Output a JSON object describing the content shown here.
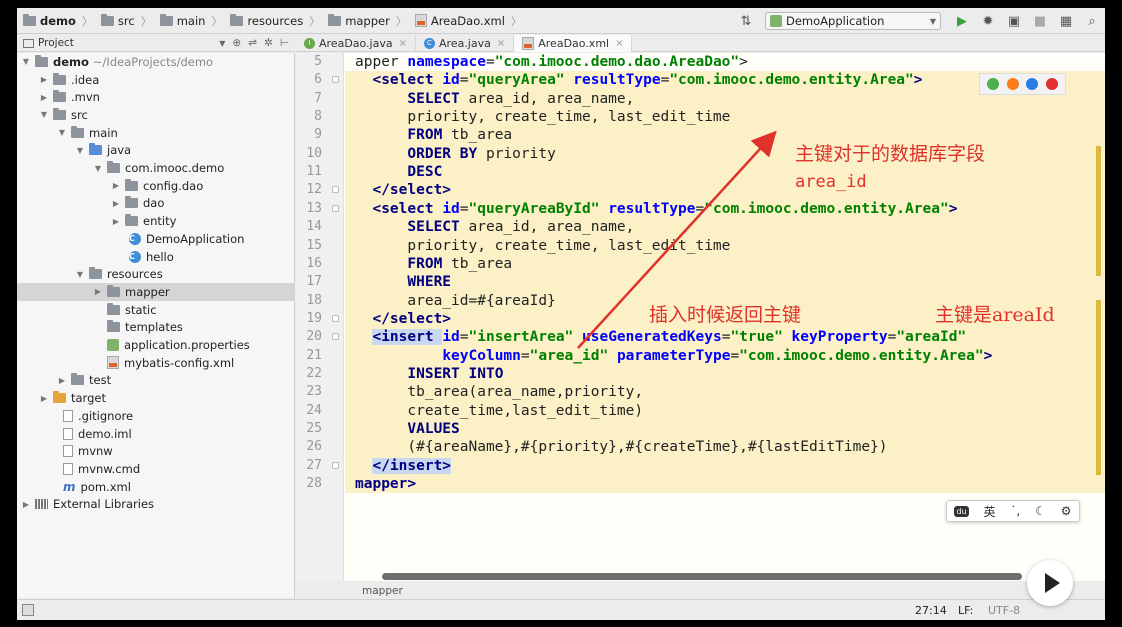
{
  "navbar": {
    "crumbs": [
      "demo",
      "src",
      "main",
      "resources",
      "mapper",
      "AreaDao.xml"
    ],
    "run_config": "DemoApplication"
  },
  "project_panel": {
    "title": "Project",
    "items": [
      {
        "label": "demo",
        "hint": "~/IdeaProjects/demo"
      },
      {
        "label": ".idea"
      },
      {
        "label": ".mvn"
      },
      {
        "label": "src"
      },
      {
        "label": "main"
      },
      {
        "label": "java"
      },
      {
        "label": "com.imooc.demo"
      },
      {
        "label": "config.dao"
      },
      {
        "label": "dao"
      },
      {
        "label": "entity"
      },
      {
        "label": "DemoApplication"
      },
      {
        "label": "hello"
      },
      {
        "label": "resources"
      },
      {
        "label": "mapper"
      },
      {
        "label": "static"
      },
      {
        "label": "templates"
      },
      {
        "label": "application.properties"
      },
      {
        "label": "mybatis-config.xml"
      },
      {
        "label": "test"
      },
      {
        "label": "target"
      },
      {
        "label": ".gitignore"
      },
      {
        "label": "demo.iml"
      },
      {
        "label": "mvnw"
      },
      {
        "label": "mvnw.cmd"
      },
      {
        "label": "pom.xml"
      },
      {
        "label": "External Libraries"
      }
    ]
  },
  "tabs": [
    {
      "label": "AreaDao.java"
    },
    {
      "label": "Area.java"
    },
    {
      "label": "AreaDao.xml"
    }
  ],
  "editor": {
    "line_numbers": [
      "5",
      "6",
      "7",
      "8",
      "9",
      "10",
      "11",
      "12",
      "13",
      "14",
      "15",
      "16",
      "17",
      "18",
      "19",
      "20",
      "21",
      "22",
      "23",
      "24",
      "25",
      "26",
      "27",
      "28"
    ],
    "lines": [
      [
        [
          "t",
          "apper "
        ],
        [
          "at",
          "namespace"
        ],
        [
          "t",
          "="
        ],
        [
          "sv",
          "\"com.imooc.demo.dao.AreaDao\""
        ],
        [
          "t",
          ">"
        ]
      ],
      [
        [
          "t",
          "  "
        ],
        [
          "tg",
          "<select "
        ],
        [
          "at",
          "id"
        ],
        [
          "t",
          "="
        ],
        [
          "sv",
          "\"queryArea\" "
        ],
        [
          "at",
          "resultType"
        ],
        [
          "t",
          "="
        ],
        [
          "sv",
          "\"com.imooc.demo.entity.Area\""
        ],
        [
          "tg",
          ">"
        ]
      ],
      [
        [
          "t",
          "      "
        ],
        [
          "kw",
          "SELECT "
        ],
        [
          "t",
          "area_id, area_name,"
        ]
      ],
      [
        [
          "t",
          "      priority, create_time, last_edit_time"
        ]
      ],
      [
        [
          "t",
          "      "
        ],
        [
          "kw",
          "FROM "
        ],
        [
          "t",
          "tb_area"
        ]
      ],
      [
        [
          "t",
          "      "
        ],
        [
          "kw",
          "ORDER BY "
        ],
        [
          "t",
          "priority"
        ]
      ],
      [
        [
          "t",
          "      "
        ],
        [
          "kw",
          "DESC"
        ]
      ],
      [
        [
          "t",
          "  "
        ],
        [
          "tg",
          "</select>"
        ]
      ],
      [
        [
          "t",
          "  "
        ],
        [
          "tg",
          "<select "
        ],
        [
          "at",
          "id"
        ],
        [
          "t",
          "="
        ],
        [
          "sv",
          "\"queryAreaById\" "
        ],
        [
          "at",
          "resultType"
        ],
        [
          "t",
          "="
        ],
        [
          "sv",
          "\"com.imooc.demo.entity.Area\""
        ],
        [
          "tg",
          ">"
        ]
      ],
      [
        [
          "t",
          "      "
        ],
        [
          "kw",
          "SELECT "
        ],
        [
          "t",
          "area_id, area_name,"
        ]
      ],
      [
        [
          "t",
          "      priority, create_time, last_edit_time"
        ]
      ],
      [
        [
          "t",
          "      "
        ],
        [
          "kw",
          "FROM "
        ],
        [
          "t",
          "tb_area"
        ]
      ],
      [
        [
          "t",
          "      "
        ],
        [
          "kw",
          "WHERE"
        ]
      ],
      [
        [
          "t",
          "      area_id=#{areaId}"
        ]
      ],
      [
        [
          "t",
          "  "
        ],
        [
          "tg",
          "</select>"
        ]
      ],
      [
        [
          "t",
          "  "
        ],
        [
          "tgb",
          "<insert "
        ],
        [
          "at",
          "id"
        ],
        [
          "t",
          "="
        ],
        [
          "sv",
          "\"insertArea\" "
        ],
        [
          "at",
          "useGeneratedKeys"
        ],
        [
          "t",
          "="
        ],
        [
          "sv",
          "\"true\" "
        ],
        [
          "at",
          "keyProperty"
        ],
        [
          "t",
          "="
        ],
        [
          "sv",
          "\"areaId\""
        ]
      ],
      [
        [
          "t",
          "          "
        ],
        [
          "at",
          "keyColumn"
        ],
        [
          "t",
          "="
        ],
        [
          "sv",
          "\"area_id\" "
        ],
        [
          "at",
          "parameterType"
        ],
        [
          "t",
          "="
        ],
        [
          "sv",
          "\"com.imooc.demo.entity.Area\""
        ],
        [
          "tg",
          ">"
        ]
      ],
      [
        [
          "t",
          "      "
        ],
        [
          "kw",
          "INSERT INTO"
        ]
      ],
      [
        [
          "t",
          "      tb_area(area_name,priority,"
        ]
      ],
      [
        [
          "t",
          "      create_time,last_edit_time)"
        ]
      ],
      [
        [
          "t",
          "      "
        ],
        [
          "kw",
          "VALUES"
        ]
      ],
      [
        [
          "t",
          "      (#{areaName},#{priority},#{createTime},#{lastEditTime})"
        ]
      ],
      [
        [
          "t",
          "  "
        ],
        [
          "tgb",
          "</insert>"
        ]
      ],
      [
        [
          "t",
          ""
        ],
        [
          "tg",
          "mapper>"
        ]
      ]
    ]
  },
  "annotations": {
    "field_note": "主键对于的数据库字段",
    "field_name": "area_id",
    "return_note": "插入时候返回主键",
    "key_note": "主键是areaId"
  },
  "bottom_breadcrumb": "mapper",
  "status": {
    "position": "27:14",
    "line_sep": "LF:",
    "encoding": "UTF-8"
  },
  "ime": {
    "lang": "英"
  },
  "colors": {
    "keyword": "#000080",
    "attribute": "#0000ff",
    "string": "#008000",
    "annotation": "#e0312b",
    "highlight": "#fbf0c6"
  }
}
